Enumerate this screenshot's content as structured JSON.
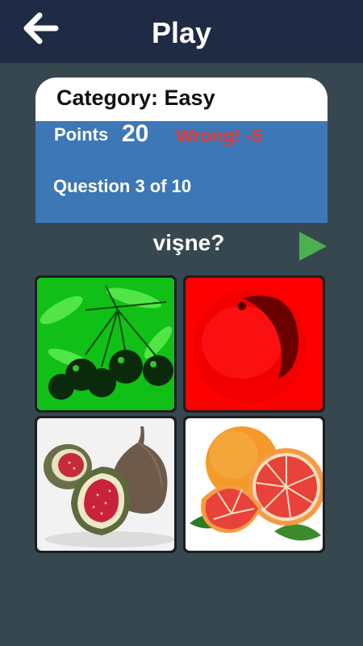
{
  "header": {
    "title": "Play",
    "back_icon": "arrow-left-icon"
  },
  "card": {
    "category": "Category: Easy",
    "points_label": "Points",
    "points_value": "20",
    "feedback": "Wrong! -5",
    "question_progress": "Question 3 of 10"
  },
  "question": {
    "word": "vişne?",
    "play_icon": "play-icon"
  },
  "options": [
    {
      "image": "cherries-green-tinted"
    },
    {
      "image": "fruit-red-tinted"
    },
    {
      "image": "figs"
    },
    {
      "image": "grapefruit"
    }
  ],
  "colors": {
    "topbar": "#1f2a44",
    "background": "#37474f",
    "card_body": "#3d77b6",
    "feedback_red": "#e53935",
    "play_green": "#4caf50"
  }
}
